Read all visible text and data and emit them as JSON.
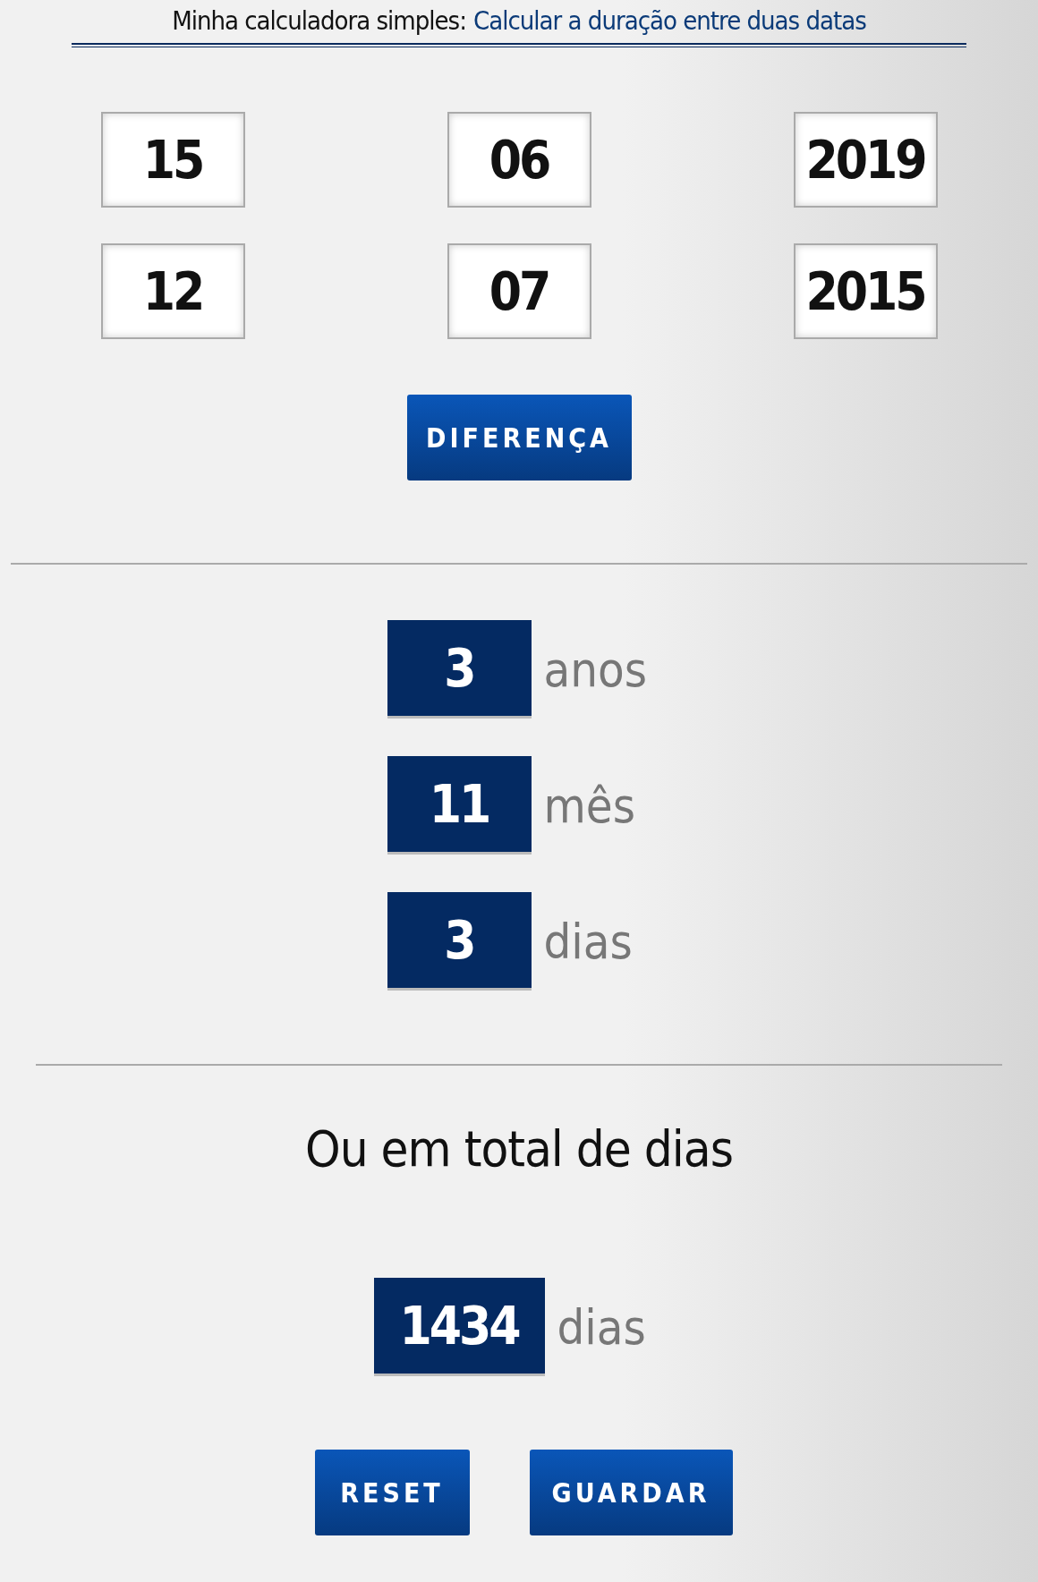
{
  "title": {
    "prefix": "Minha calculadora simples:",
    "link": "Calcular a duração entre duas datas"
  },
  "dates": [
    {
      "day": "15",
      "month": "06",
      "year": "2019"
    },
    {
      "day": "12",
      "month": "07",
      "year": "2015"
    }
  ],
  "calculate_button": "DIFERENÇA",
  "results": [
    {
      "value": "3",
      "unit": "anos"
    },
    {
      "value": "11",
      "unit": "mês"
    },
    {
      "value": "3",
      "unit": "dias"
    }
  ],
  "total": {
    "heading": "Ou em total de dias",
    "value": "1434",
    "unit": "dias"
  },
  "buttons": [
    "RESET",
    "GUARDAR"
  ]
}
